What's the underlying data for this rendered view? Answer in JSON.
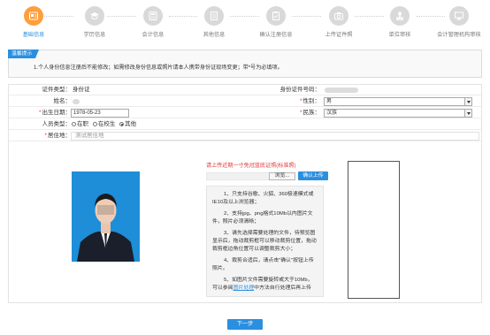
{
  "steps": [
    {
      "label": "基础信息",
      "icon": "id-card-icon",
      "active": true
    },
    {
      "label": "学历信息",
      "icon": "graduation-cap-icon",
      "active": false
    },
    {
      "label": "会计信息",
      "icon": "calculator-icon",
      "active": false
    },
    {
      "label": "其他信息",
      "icon": "document-icon",
      "active": false
    },
    {
      "label": "确认注册信息",
      "icon": "clipboard-icon",
      "active": false
    },
    {
      "label": "上传证件照",
      "icon": "camera-icon",
      "active": false
    },
    {
      "label": "单位审核",
      "icon": "stamp-icon",
      "active": false
    },
    {
      "label": "会计管理机构审核",
      "icon": "monitor-icon",
      "active": false
    }
  ],
  "notice": {
    "tag": "温馨提示",
    "text": "1.个人身份信息注册后不能修改；如需修改身份信息或照片请本人携带身份证现场变更；带*号为必填项。"
  },
  "form": {
    "id_type_label": "证件类型：",
    "id_type_value": "身份证",
    "id_number_label": "身份证件号码：",
    "name_label": "姓名：",
    "gender_label": "性别：",
    "gender_value": "男",
    "birth_label": "出生日期：",
    "birth_value": "1978-05-23",
    "ethnicity_label": "民族：",
    "ethnicity_value": "汉族",
    "person_type_label": "人员类型：",
    "person_type_options": [
      "在职",
      "在校生",
      "其他"
    ],
    "address_label": "居住地：",
    "address_placeholder": "测试居住地"
  },
  "photo": {
    "warning": "请上传近期一寸免冠蓝底证照(标准照)",
    "browse_label": "浏览...",
    "upload_label": "确认上传",
    "tips": [
      "1、只支持谷歌、火狐、360极速模式或IE10及以上浏览器；",
      "2、支持jpg、png格式10Mb以内图片文件，照片必须清晰；",
      "3、请先选择需要处理的文件，待预览图显示后，拖动裁剪框可以移动裁剪位置，拖动裁剪框边角位置可以调整裁剪大小；",
      "4、裁剪合适后，请点击\"确认\"按钮上传照片。"
    ],
    "tip5_a": "5、如图片文件需要旋转或大于10Mb，可以参阅",
    "tip5_link": "图片处理",
    "tip5_b": "中方法自行处理后再上传"
  },
  "next_label": "下一步",
  "colors": {
    "accent": "#2b8fe0",
    "active_step": "#ff9e3d",
    "required": "#e4393c"
  }
}
